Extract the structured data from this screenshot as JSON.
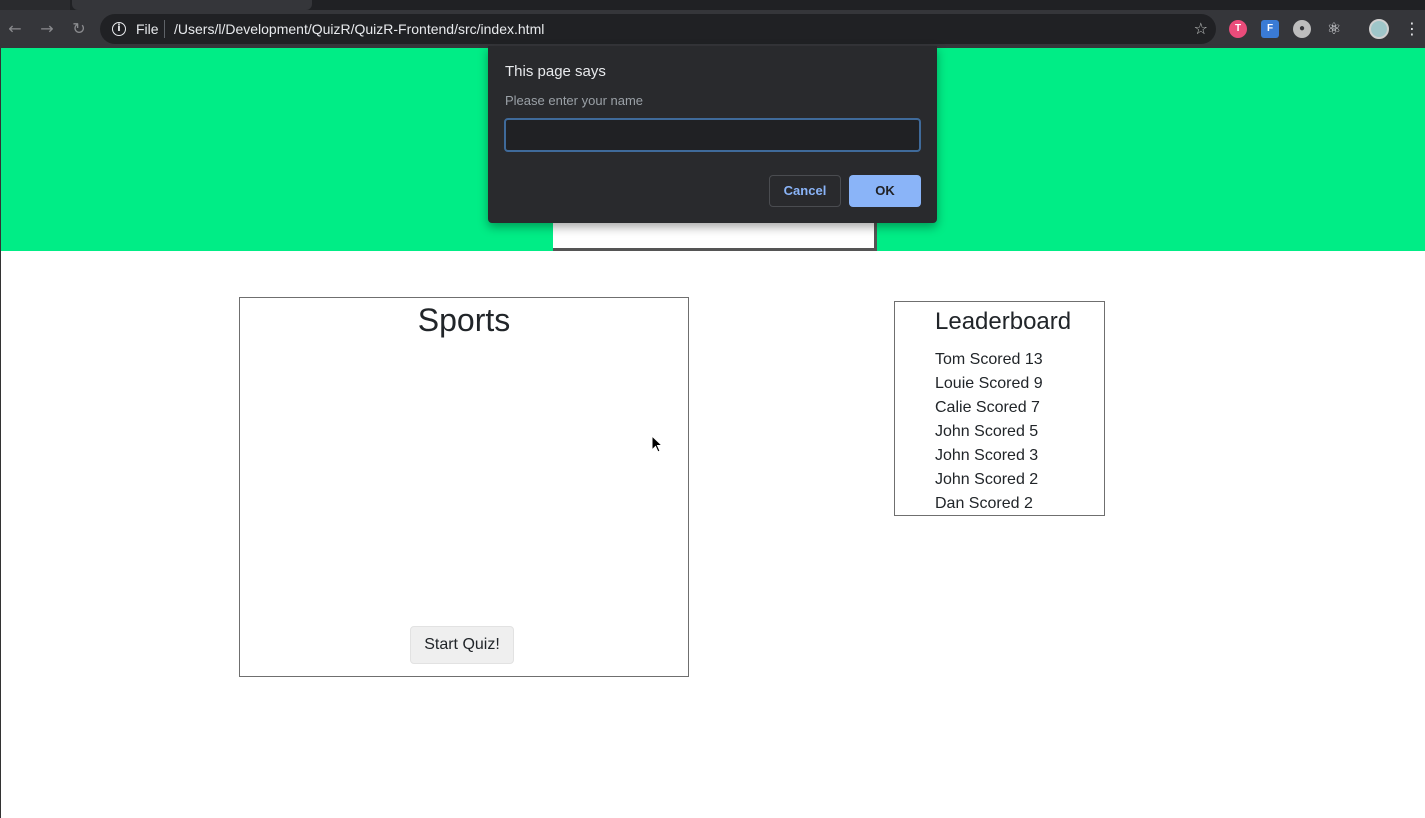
{
  "browser": {
    "url_scheme": "File",
    "url": "/Users/l/Development/QuizR/QuizR-Frontend/src/index.html",
    "back_icon": "arrow-left-icon",
    "forward_icon": "arrow-right-icon",
    "reload_icon": "reload-icon",
    "star_icon": "star-icon",
    "extensions": [
      "T",
      "F",
      "",
      ""
    ]
  },
  "quiz": {
    "title": "Sports",
    "start_label": "Start Quiz!"
  },
  "leaderboard": {
    "title": "Leaderboard",
    "entries": [
      "Tom Scored 13",
      "Louie Scored 9",
      "Calie Scored 7",
      "John Scored 5",
      "John Scored 3",
      "John Scored 2",
      "Dan Scored 2"
    ]
  },
  "dialog": {
    "title": "This page says",
    "message": "Please enter your name",
    "input_value": "",
    "cancel_label": "Cancel",
    "ok_label": "OK"
  },
  "colors": {
    "hero": "#00ed86",
    "ok_button": "#8ab4f8"
  }
}
